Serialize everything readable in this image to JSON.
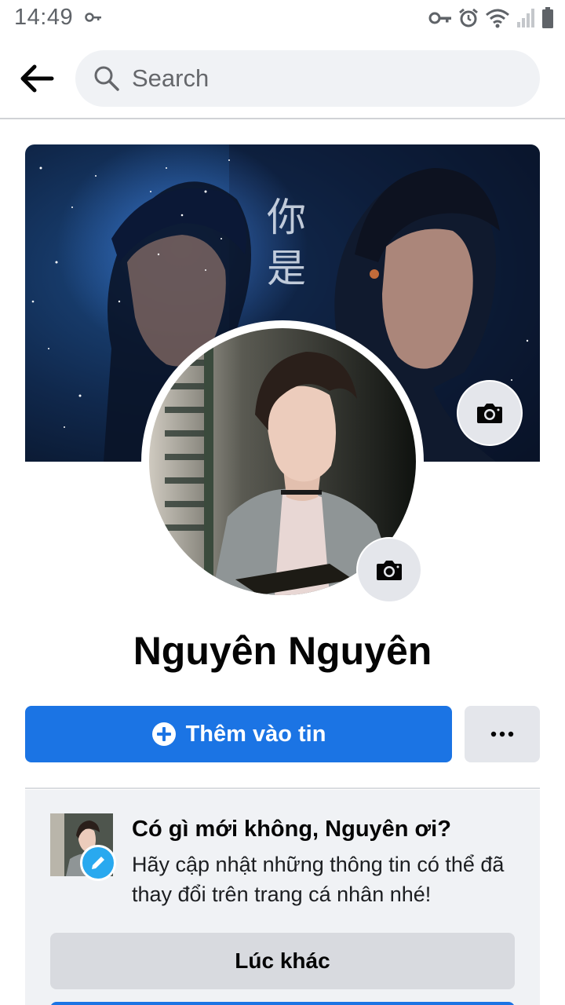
{
  "status_bar": {
    "time": "14:49"
  },
  "header": {
    "search_placeholder": "Search"
  },
  "profile": {
    "name": "Nguyên Nguyên"
  },
  "actions": {
    "add_story_label": "Thêm vào tin",
    "more_label": "•••"
  },
  "prompt": {
    "title": "Có gì mới không, Nguyên ơi?",
    "body": "Hãy cập nhật những thông tin có thể đã thay đổi trên trang cá nhân nhé!",
    "later_label": "Lúc khác"
  },
  "colors": {
    "accent": "#1b74e4",
    "secondary_button": "#e4e6eb",
    "card_background": "#f0f2f5",
    "edit_badge": "#29a9ef"
  },
  "icons": {
    "back": "arrow-left-icon",
    "search": "search-icon",
    "camera": "camera-icon",
    "add": "plus-circle-icon",
    "more": "more-horizontal-icon",
    "edit": "pencil-icon"
  }
}
